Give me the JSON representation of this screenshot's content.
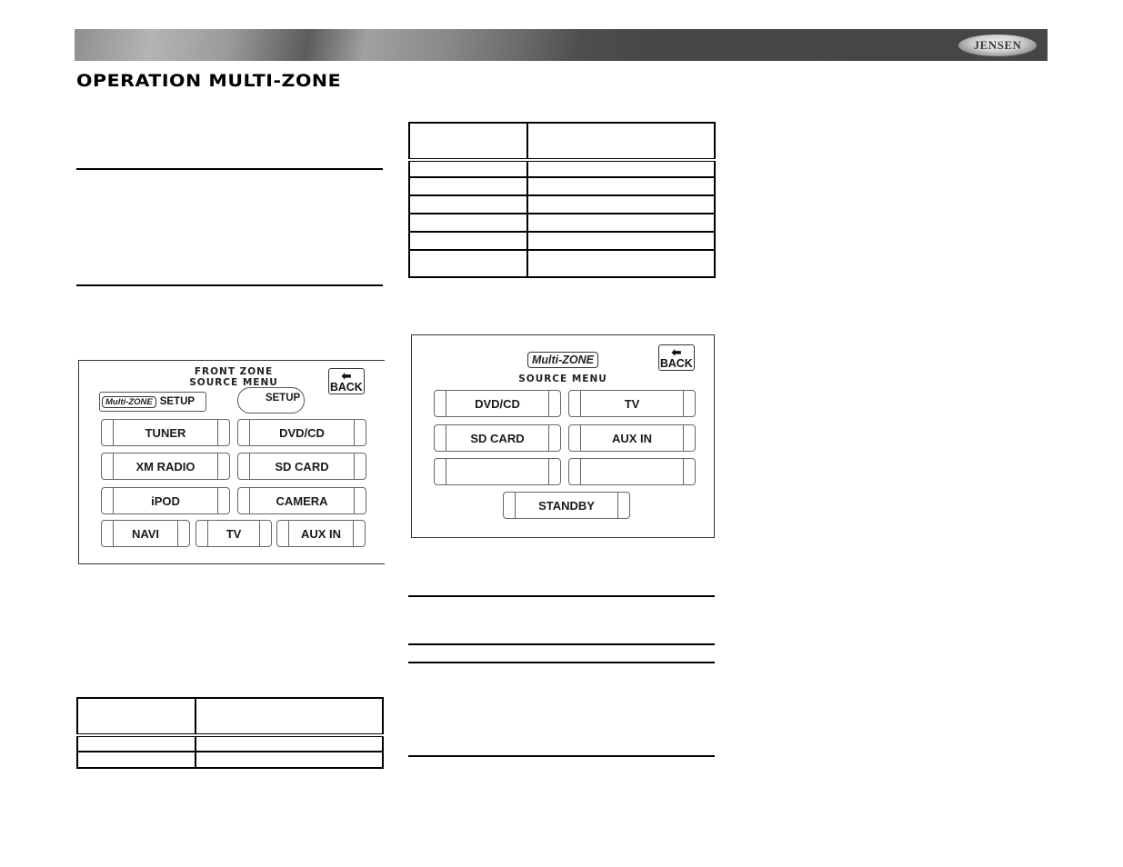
{
  "header": {
    "brand_logo": "JENSEN",
    "page_title": "OPERATION MULTI-ZONE"
  },
  "front_zone_menu": {
    "title_line1": "FRONT ZONE",
    "title_line2": "SOURCE MENU",
    "back_label": "BACK",
    "back_icon": "left-arrow-icon",
    "multizone_badge": "Multi-ZONE",
    "multizone_setup_label": "SETUP",
    "setup_label": "SETUP",
    "buttons": [
      "TUNER",
      "DVD/CD",
      "XM RADIO",
      "SD CARD",
      "iPOD",
      "CAMERA",
      "NAVI",
      "TV",
      "AUX IN"
    ]
  },
  "multizone_menu": {
    "badge": "Multi-ZONE",
    "title": "SOURCE MENU",
    "back_label": "BACK",
    "back_icon": "left-arrow-icon",
    "buttons": [
      "DVD/CD",
      "TV",
      "SD CARD",
      "AUX IN",
      "",
      ""
    ],
    "standby_label": "STANDBY"
  }
}
